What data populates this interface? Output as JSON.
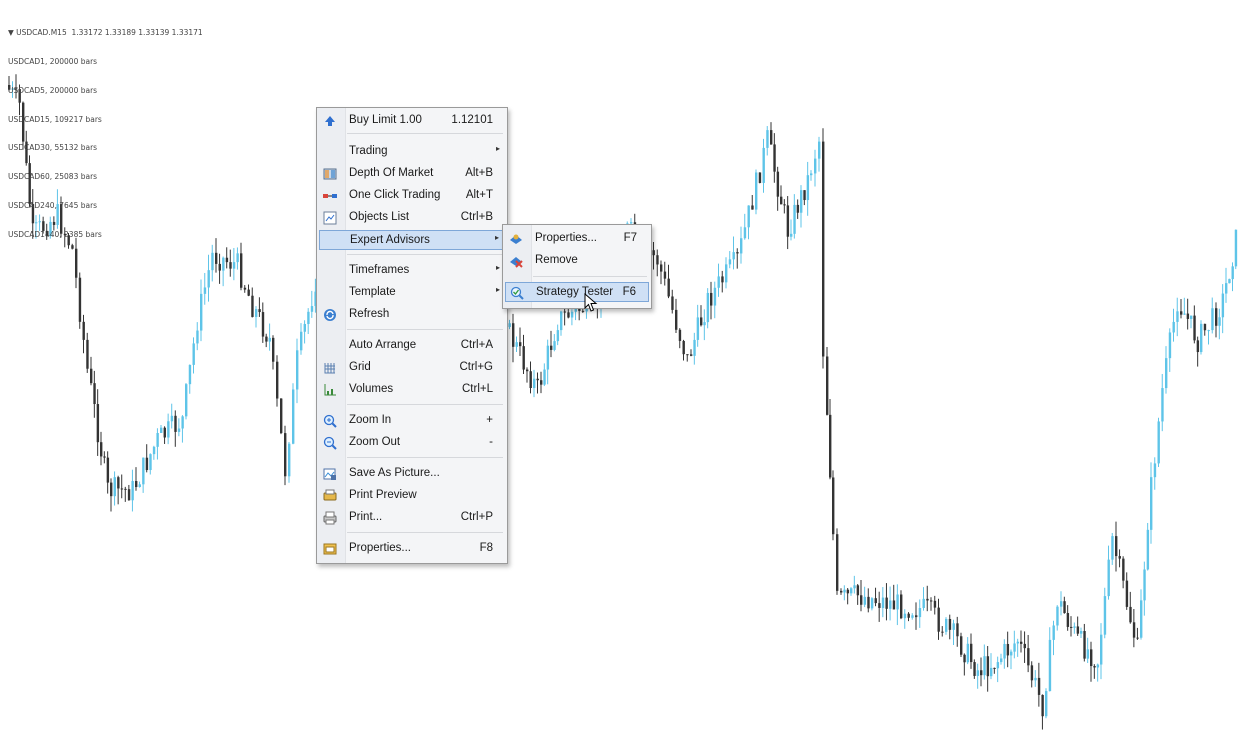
{
  "chart": {
    "header": "▼ USDCAD.M15  1.33172 1.33189 1.33139 1.33171",
    "bars_info": [
      "USDCAD1, 200000 bars",
      "USDCAD5, 200000 bars",
      "USDCAD15, 109217 bars",
      "USDCAD30, 55132 bars",
      "USDCAD60, 25083 bars",
      "USDCAD240, 7645 bars",
      "USDCAD1440, 2385 bars"
    ],
    "colors": {
      "bull": "#5ec4e8",
      "bear": "#333333",
      "background": "#ffffff"
    }
  },
  "context_menu": {
    "items": [
      {
        "label": "Buy Limit 1.00",
        "shortcut": "1.12101",
        "icon": "buy-limit-icon"
      },
      {
        "label": "Trading",
        "shortcut": "",
        "submenu": true
      },
      {
        "label": "Depth Of Market",
        "shortcut": "Alt+B",
        "icon": "depth-of-market-icon"
      },
      {
        "label": "One Click Trading",
        "shortcut": "Alt+T",
        "icon": "one-click-trading-icon"
      },
      {
        "label": "Objects List",
        "shortcut": "Ctrl+B",
        "icon": "objects-list-icon"
      },
      {
        "label": "Expert Advisors",
        "shortcut": "",
        "submenu": true,
        "highlighted": true
      },
      {
        "label": "Timeframes",
        "shortcut": "",
        "submenu": true
      },
      {
        "label": "Template",
        "shortcut": "",
        "submenu": true
      },
      {
        "label": "Refresh",
        "shortcut": "",
        "icon": "refresh-icon"
      },
      {
        "label": "Auto Arrange",
        "shortcut": "Ctrl+A"
      },
      {
        "label": "Grid",
        "shortcut": "Ctrl+G",
        "icon": "grid-icon"
      },
      {
        "label": "Volumes",
        "shortcut": "Ctrl+L",
        "icon": "volumes-icon"
      },
      {
        "label": "Zoom In",
        "shortcut": "+",
        "icon": "zoom-in-icon"
      },
      {
        "label": "Zoom Out",
        "shortcut": "-",
        "icon": "zoom-out-icon"
      },
      {
        "label": "Save As Picture...",
        "shortcut": "",
        "icon": "save-picture-icon"
      },
      {
        "label": "Print Preview",
        "shortcut": "",
        "icon": "print-preview-icon"
      },
      {
        "label": "Print...",
        "shortcut": "Ctrl+P",
        "icon": "print-icon"
      },
      {
        "label": "Properties...",
        "shortcut": "F8",
        "icon": "properties-icon"
      }
    ]
  },
  "submenu": {
    "items": [
      {
        "label": "Properties...",
        "shortcut": "F7",
        "icon": "ea-properties-icon"
      },
      {
        "label": "Remove",
        "shortcut": "",
        "icon": "ea-remove-icon"
      },
      {
        "label": "Strategy Tester",
        "shortcut": "F6",
        "icon": "strategy-tester-icon",
        "highlighted": true
      }
    ]
  }
}
